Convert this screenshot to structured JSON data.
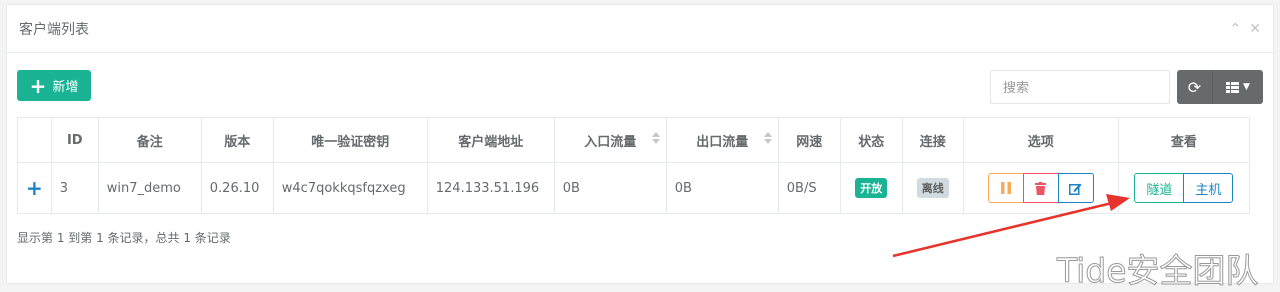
{
  "panel": {
    "title": "客户端列表"
  },
  "toolbar": {
    "add_label": "新增",
    "search_placeholder": "搜索"
  },
  "table": {
    "columns": [
      "",
      "ID",
      "备注",
      "版本",
      "唯一验证密钥",
      "客户端地址",
      "入口流量",
      "出口流量",
      "网速",
      "状态",
      "连接",
      "选项",
      "查看"
    ],
    "rows": [
      {
        "expand": "+",
        "id": "3",
        "remark": "win7_demo",
        "version": "0.26.10",
        "key": "w4c7qokkqsfqzxeg",
        "address": "124.133.51.196",
        "in_traffic": "0B",
        "out_traffic": "0B",
        "speed": "0B/S",
        "status": "开放",
        "connection": "离线",
        "view_tunnel": "隧道",
        "view_host": "主机"
      }
    ]
  },
  "pagination": {
    "info": "显示第 1 到第 1 条记录，总共 1 条记录"
  },
  "watermark": "Tide安全团队",
  "colors": {
    "primary": "#1ab394",
    "warning": "#f8ac59",
    "danger": "#ed5565",
    "info": "#1c84c6",
    "arrow": "#e8322c"
  }
}
